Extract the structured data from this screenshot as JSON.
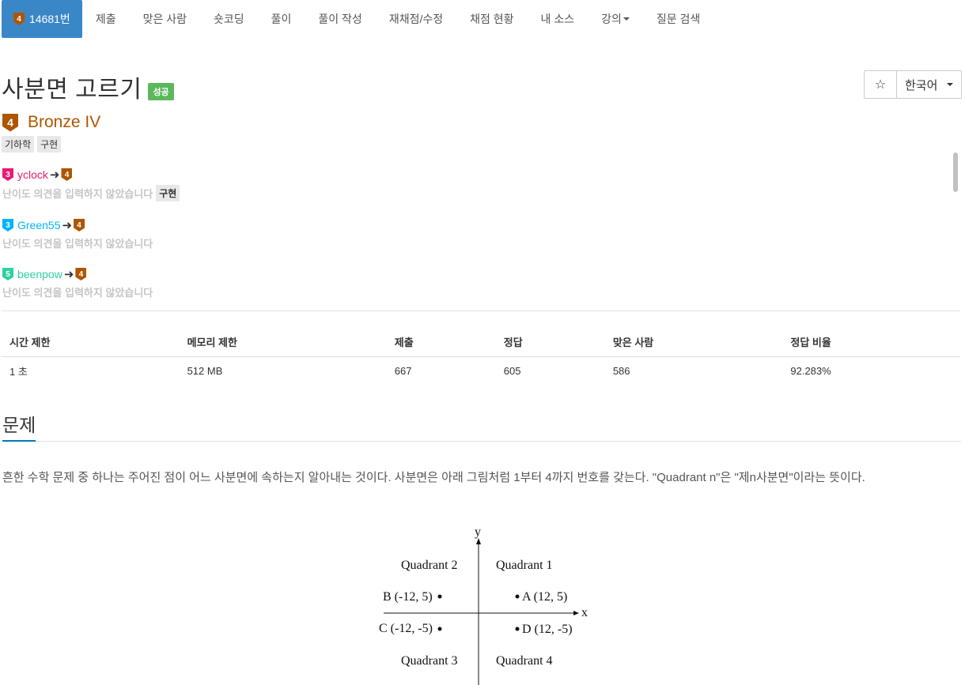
{
  "nav": {
    "problem_id": "14681번",
    "problem_tier": "4",
    "items": [
      "제출",
      "맞은 사람",
      "숏코딩",
      "풀이",
      "풀이 작성",
      "재채점/수정",
      "채점 현황",
      "내 소스",
      "강의",
      "질문 검색"
    ]
  },
  "problem": {
    "title": "사분면 고르기",
    "status_badge": "성공",
    "tier_number": "4",
    "tier_name": "Bronze IV",
    "tags": [
      "기하학",
      "구현"
    ]
  },
  "controls": {
    "star": "☆",
    "language": "한국어"
  },
  "opinions": [
    {
      "user_tier": "3",
      "user": "yclock",
      "target_tier": "4",
      "text": "난이도 의견을 입력하지 않았습니다",
      "tag": "구현"
    },
    {
      "user_tier": "3",
      "user": "Green55",
      "target_tier": "4",
      "text": "난이도 의견을 입력하지 않았습니다",
      "tag": ""
    },
    {
      "user_tier": "5",
      "user": "beenpow",
      "target_tier": "4",
      "text": "난이도 의견을 입력하지 않았습니다",
      "tag": ""
    }
  ],
  "stats": {
    "headers": [
      "시간 제한",
      "메모리 제한",
      "제출",
      "정답",
      "맞은 사람",
      "정답 비율"
    ],
    "values": [
      "1 초",
      "512 MB",
      "667",
      "605",
      "586",
      "92.283%"
    ]
  },
  "section": {
    "title": "문제",
    "description": "흔한 수학 문제 중 하나는 주어진 점이 어느 사분면에 속하는지 알아내는 것이다. 사분면은 아래 그림처럼 1부터 4까지 번호를 갖는다. \"Quadrant n\"은 \"제n사분면\"이라는 뜻이다."
  },
  "figure": {
    "axis_x": "x",
    "axis_y": "y",
    "q1": "Quadrant 1",
    "q2": "Quadrant 2",
    "q3": "Quadrant 3",
    "q4": "Quadrant 4",
    "pa": "A (12, 5)",
    "pb": "B (-12, 5)",
    "pc": "C (-12, -5)",
    "pd": "D (12, -5)"
  }
}
